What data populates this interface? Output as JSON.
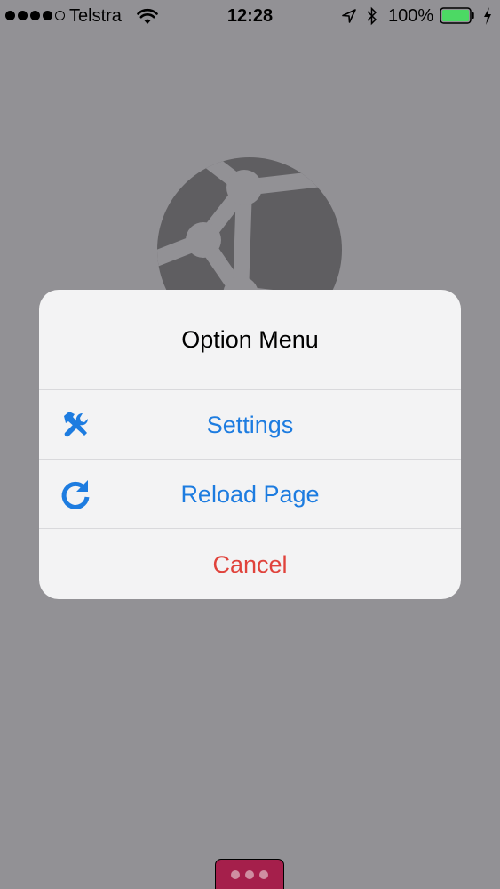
{
  "status_bar": {
    "carrier": "Telstra",
    "time": "12:28",
    "battery": "100%",
    "signal_bars_filled": 4,
    "signal_bars_total": 5,
    "icons": [
      "wifi-icon",
      "location-icon",
      "bluetooth-icon",
      "battery-icon",
      "charging-icon"
    ]
  },
  "background": {
    "icon": "globe-icon",
    "overlay_color": "#929195"
  },
  "alert": {
    "title": "Option Menu",
    "actions": [
      {
        "label": "Settings",
        "icon": "tools-icon",
        "color": "#1d7ce0"
      },
      {
        "label": "Reload Page",
        "icon": "reload-icon",
        "color": "#1d7ce0"
      },
      {
        "label": "Cancel",
        "color": "#e0433c"
      }
    ]
  },
  "more_button": {
    "icon": "more-dots-icon",
    "color": "#a51f4b"
  }
}
